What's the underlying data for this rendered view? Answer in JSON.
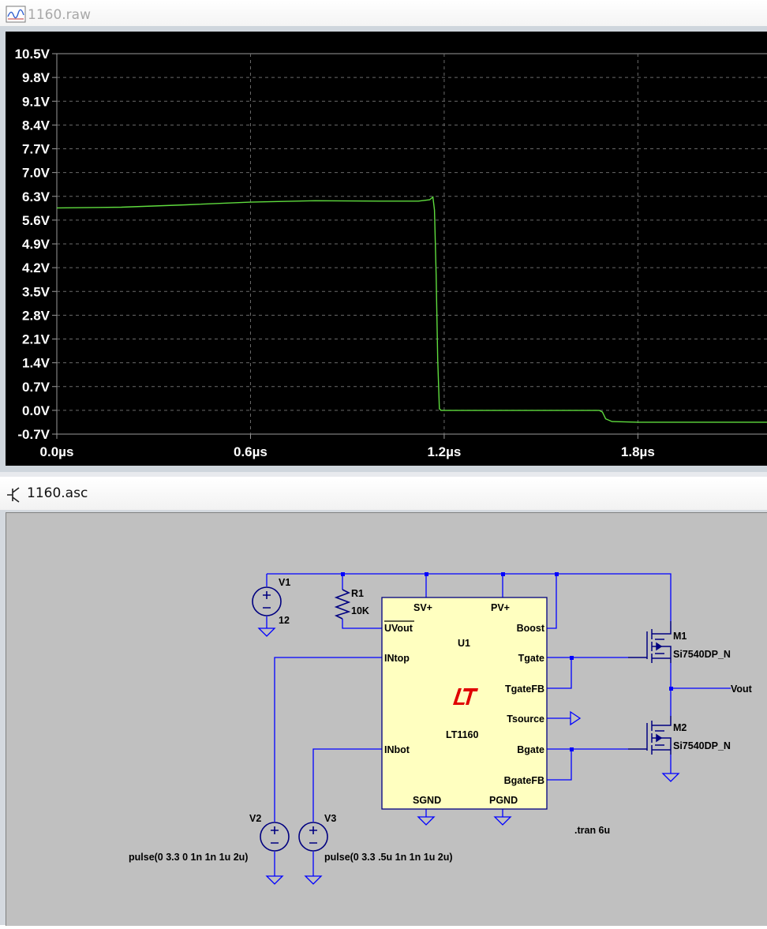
{
  "plot_window": {
    "title": "1160.raw",
    "icon": "waveform-icon"
  },
  "schematic_window": {
    "title": "1160.asc",
    "icon": "transistor-icon"
  },
  "chart_data": {
    "type": "line",
    "title": "",
    "xlabel": "",
    "ylabel": "",
    "x_ticks": [
      "0.0µs",
      "0.6µs",
      "1.2µs",
      "1.8µs"
    ],
    "y_ticks": [
      "10.5V",
      "9.8V",
      "9.1V",
      "8.4V",
      "7.7V",
      "7.0V",
      "6.3V",
      "5.6V",
      "4.9V",
      "4.2V",
      "3.5V",
      "2.8V",
      "2.1V",
      "1.4V",
      "0.7V",
      "0.0V",
      "-0.7V"
    ],
    "xlim": [
      0,
      2.2
    ],
    "ylim": [
      -0.7,
      10.5
    ],
    "x_unit": "µs",
    "y_unit": "V",
    "grid": true,
    "background_color": "#000000",
    "series": [
      {
        "color": "#5fdc3e",
        "x": [
          0,
          0.2,
          0.4,
          0.6,
          0.8,
          1.0,
          1.12,
          1.155,
          1.165,
          1.17,
          1.175,
          1.18,
          1.185,
          1.19,
          1.5,
          1.68,
          1.69,
          1.7,
          1.72,
          1.8,
          2.0,
          2.2
        ],
        "y": [
          5.96,
          5.98,
          6.05,
          6.13,
          6.17,
          6.16,
          6.16,
          6.2,
          6.28,
          5.9,
          4.0,
          1.5,
          0.05,
          0.0,
          0.0,
          0.0,
          -0.05,
          -0.25,
          -0.33,
          -0.35,
          -0.35,
          -0.35
        ]
      }
    ]
  },
  "schematic": {
    "colors": {
      "wire": "#0000ff",
      "component": "#000080",
      "label": "#000000",
      "ic_fill": "#ffffc0",
      "logo": "#e00000",
      "junction": "#0000ff"
    },
    "labels": {
      "v1_name": "V1",
      "v1_value": "12",
      "r1_name": "R1",
      "r1_value": "10K",
      "u1_name": "U1",
      "u1_part": "LT1160",
      "pin_svplus": "SV+",
      "pin_pvplus": "PV+",
      "pin_uvout": "UVout",
      "pin_boost": "Boost",
      "pin_intop": "INtop",
      "pin_tgate": "Tgate",
      "pin_tgatefb": "TgateFB",
      "pin_tsource": "Tsource",
      "pin_inbot": "INbot",
      "pin_bgate": "Bgate",
      "pin_bgatefb": "BgateFB",
      "pin_sgnd": "SGND",
      "pin_pgnd": "PGND",
      "m1_name": "M1",
      "m1_part": "Si7540DP_N",
      "m2_name": "M2",
      "m2_part": "Si7540DP_N",
      "vout": "Vout",
      "v2_name": "V2",
      "v2_value": "pulse(0 3.3 0 1n 1n 1u 2u)",
      "v3_name": "V3",
      "v3_value": "pulse(0 3.3 .5u 1n 1n 1u 2u)",
      "directive": ".tran 6u"
    }
  }
}
